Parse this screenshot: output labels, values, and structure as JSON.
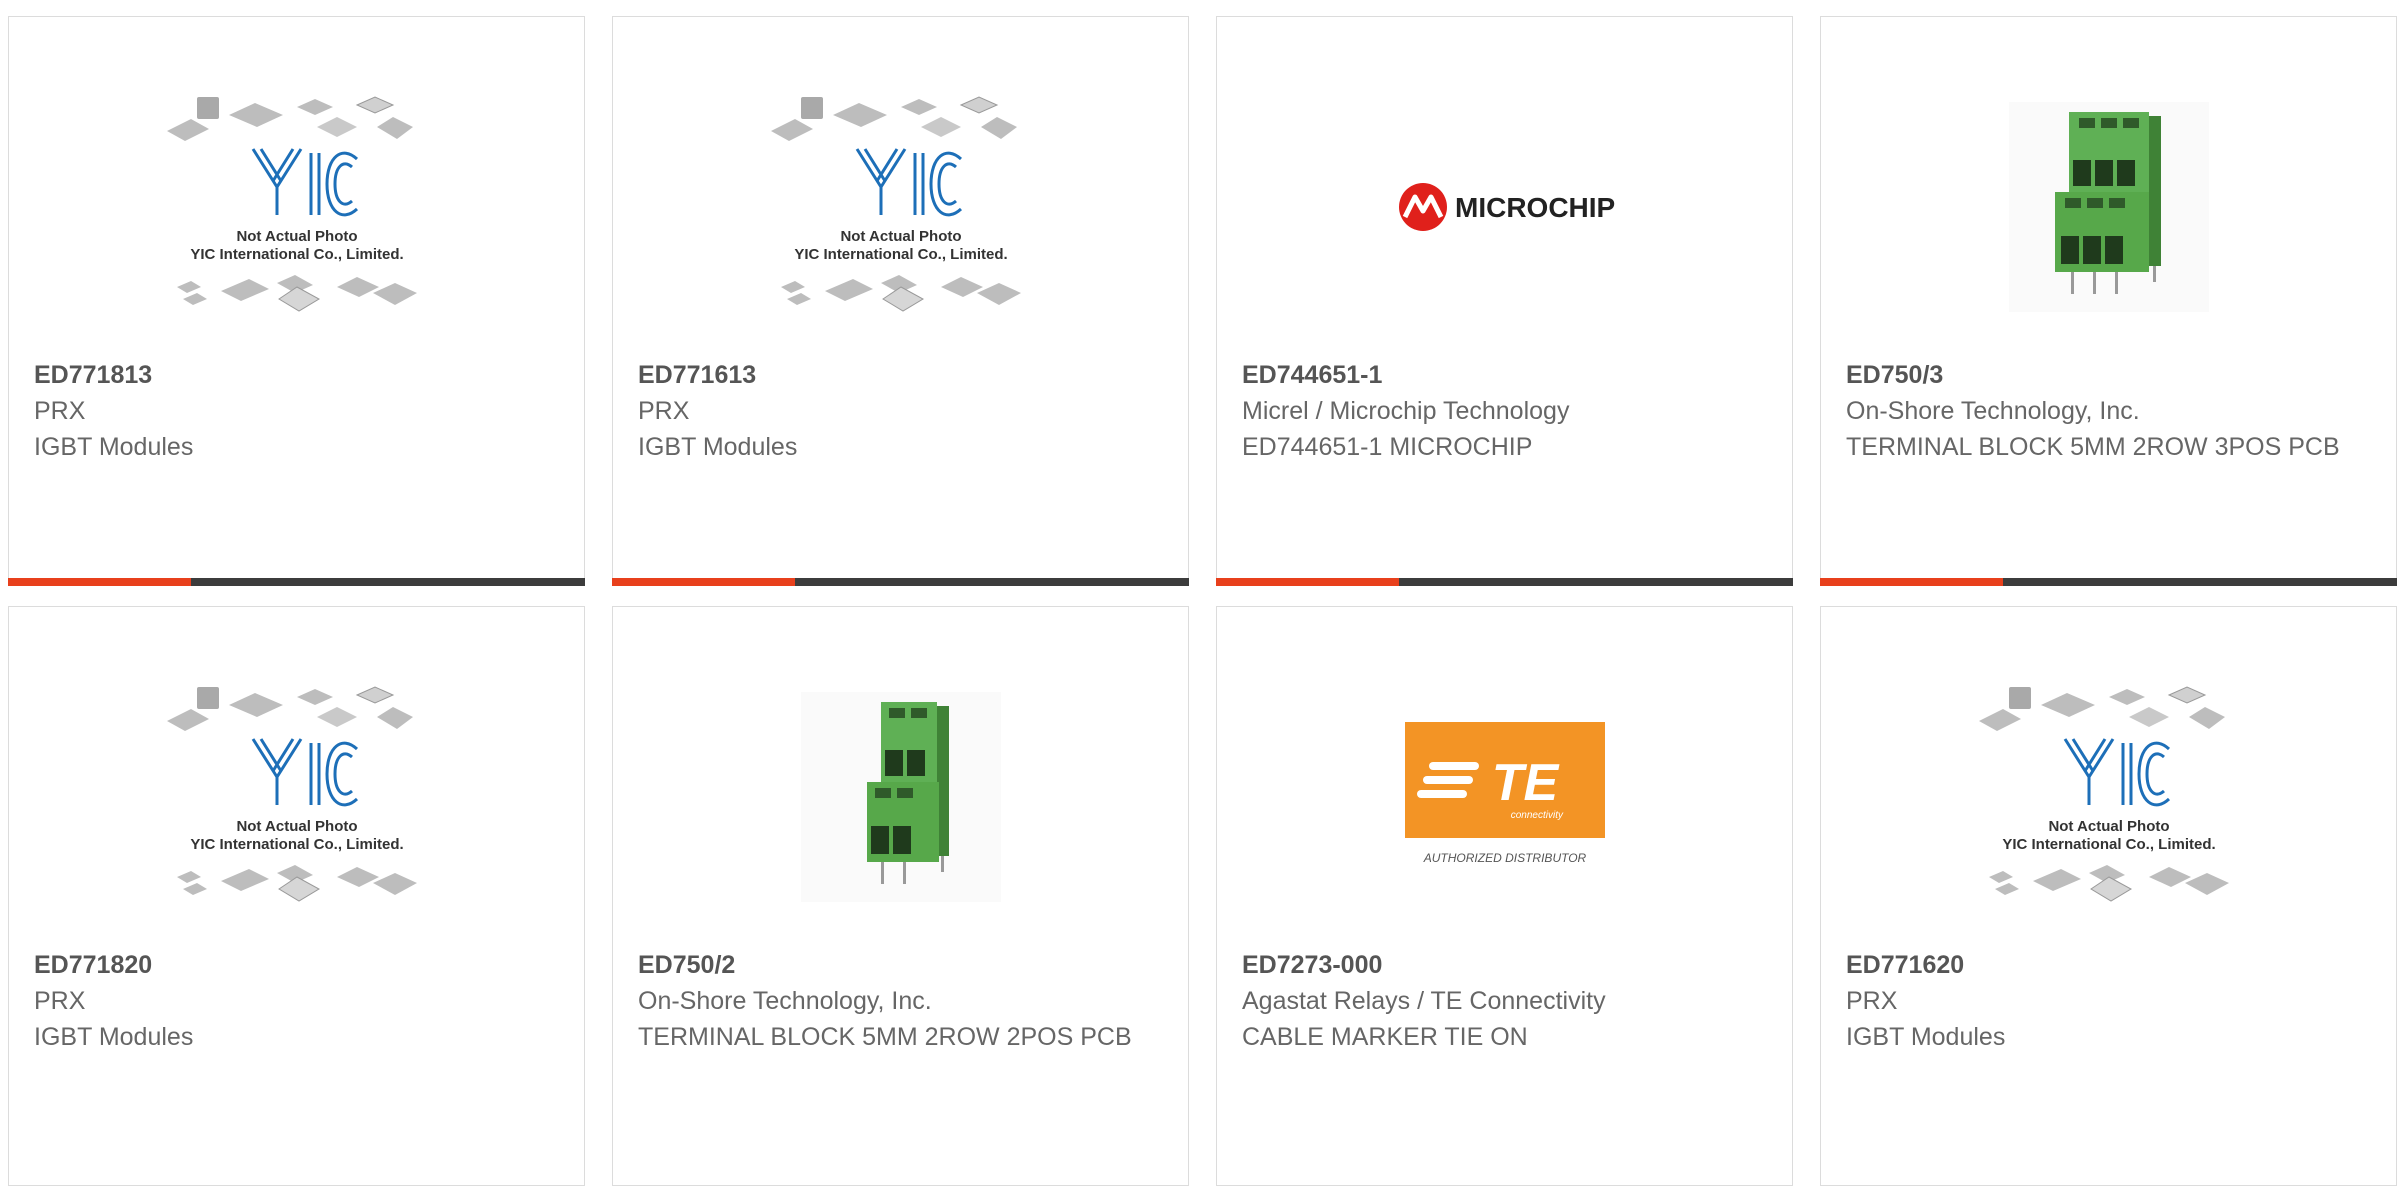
{
  "products": [
    {
      "part": "ED771813",
      "manufacturer": "PRX",
      "description": "IGBT Modules",
      "image": "placeholder-photo",
      "placeholder_line1": "Not Actual Photo",
      "placeholder_line2": "YIC International Co., Limited."
    },
    {
      "part": "ED771613",
      "manufacturer": "PRX",
      "description": "IGBT Modules",
      "image": "placeholder-photo",
      "placeholder_line1": "Not Actual Photo",
      "placeholder_line2": "YIC International Co., Limited."
    },
    {
      "part": "ED744651-1",
      "manufacturer": "Micrel / Microchip Technology",
      "description": "ED744651-1 MICROCHIP",
      "image": "microchip-logo",
      "logo_text": "MICROCHIP"
    },
    {
      "part": "ED750/3",
      "manufacturer": "On-Shore Technology, Inc.",
      "description": "TERMINAL BLOCK 5MM 2ROW 3POS PCB",
      "image": "terminal-block-3pos"
    },
    {
      "part": "ED771820",
      "manufacturer": "PRX",
      "description": "IGBT Modules",
      "image": "placeholder-photo",
      "placeholder_line1": "Not Actual Photo",
      "placeholder_line2": "YIC International Co., Limited."
    },
    {
      "part": "ED750/2",
      "manufacturer": "On-Shore Technology, Inc.",
      "description": "TERMINAL BLOCK 5MM 2ROW 2POS PCB",
      "image": "terminal-block-2pos"
    },
    {
      "part": "ED7273-000",
      "manufacturer": "Agastat Relays / TE Connectivity",
      "description": "CABLE MARKER TIE ON",
      "image": "te-connectivity-logo",
      "logo_text": "TE",
      "logo_sub": "connectivity",
      "logo_caption": "AUTHORIZED DISTRIBUTOR"
    },
    {
      "part": "ED771620",
      "manufacturer": "PRX",
      "description": "IGBT Modules",
      "image": "placeholder-photo",
      "placeholder_line1": "Not Actual Photo",
      "placeholder_line2": "YIC International Co., Limited."
    }
  ],
  "colors": {
    "accent": "#e8401c",
    "bar": "#3c3c3c",
    "yic_blue": "#1d6fb8",
    "microchip_red": "#e0201b",
    "te_orange": "#f39425",
    "green": "#57a84a"
  }
}
